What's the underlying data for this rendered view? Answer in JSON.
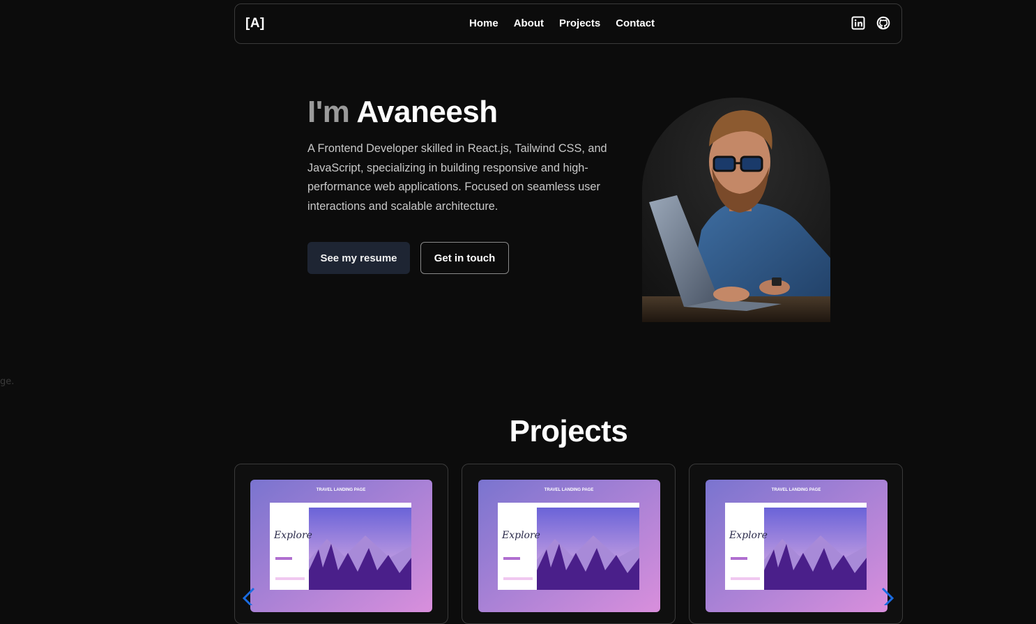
{
  "stray_text": "ge.",
  "nav": {
    "logo": "[A]",
    "links": [
      "Home",
      "About",
      "Projects",
      "Contact"
    ],
    "social_icons": [
      "linkedin-icon",
      "github-icon"
    ]
  },
  "hero": {
    "title_prefix": "I'm",
    "name": "Avaneesh",
    "description": "A Frontend Developer skilled in React.js, Tailwind CSS, and JavaScript, specializing in building responsive and high-performance web applications. Focused on seamless user interactions and scalable architecture.",
    "resume_button": "See my resume",
    "contact_button": "Get in touch"
  },
  "projects": {
    "heading": "Projects",
    "cards": [
      {
        "thumb_title": "TRAVEL LANDING PAGE",
        "thumb_logo": "Explore"
      },
      {
        "thumb_title": "TRAVEL LANDING PAGE",
        "thumb_logo": "Explore"
      },
      {
        "thumb_title": "TRAVEL LANDING PAGE",
        "thumb_logo": "Explore"
      }
    ]
  },
  "colors": {
    "background": "#0c0c0c",
    "resume_button_bg": "#1e2533",
    "muted_text": "#9a9a9a",
    "carousel_arrow": "#1a6be0"
  }
}
